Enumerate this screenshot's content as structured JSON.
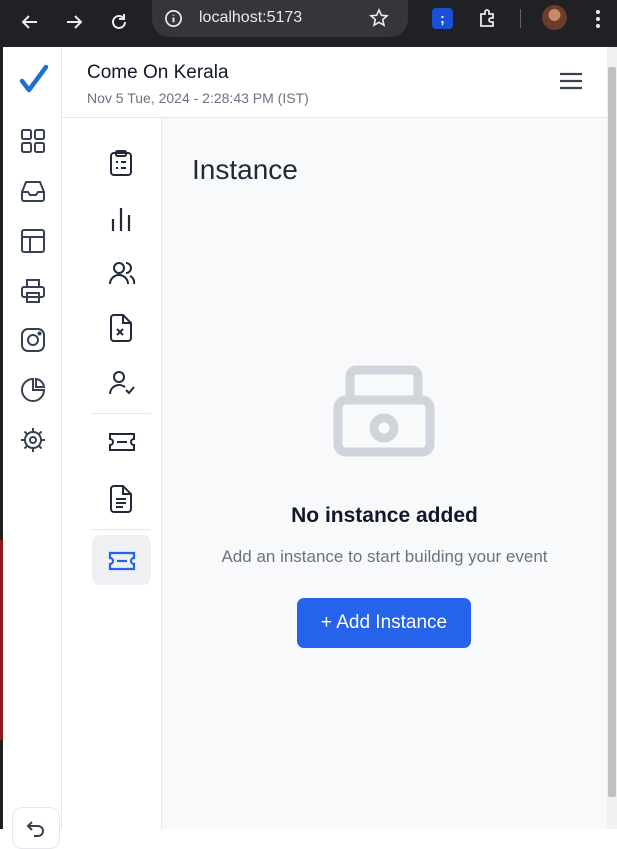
{
  "browser": {
    "url": "localhost:5173",
    "extension_badge": ";"
  },
  "header": {
    "org_name": "Come On Kerala",
    "datetime": "Nov 5 Tue, 2024 - 2:28:43 PM (IST)"
  },
  "rail": {
    "items": [
      "logo-check-icon",
      "dashboard-grid-icon",
      "inbox-icon",
      "layout-icon",
      "printer-icon",
      "instagram-icon",
      "pie-chart-icon",
      "settings-icon"
    ],
    "accent": "#1d6fd1"
  },
  "subnav": {
    "items": [
      "clipboard-list-icon",
      "bar-chart-icon",
      "users-icon",
      "file-x-icon",
      "user-check-icon",
      "ticket-icon",
      "file-text-icon",
      "ticket-active-icon"
    ],
    "active": "ticket-active-icon"
  },
  "main": {
    "title": "Instance",
    "empty_title": "No instance added",
    "empty_subtitle": "Add an instance to start building your event",
    "add_button": "+ Add Instance"
  },
  "colors": {
    "primary": "#2563eb",
    "active_bg": "#eef0f4",
    "muted": "#6b7280"
  }
}
